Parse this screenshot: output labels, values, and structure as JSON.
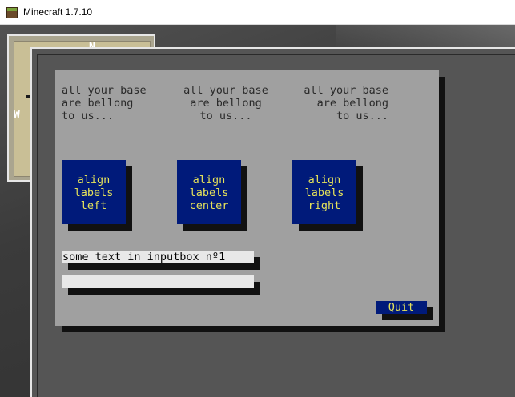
{
  "window": {
    "title": "Minecraft 1.7.10"
  },
  "minimap": {
    "north": "N",
    "west": "W"
  },
  "labels": {
    "left": "all your base\nare bellong\nto us...",
    "center": "all your base\nare bellong\nto us...",
    "right": "all your base\nare bellong\nto us..."
  },
  "buttons": {
    "align_left": "align\nlabels\nleft",
    "align_center": "align\nlabels\ncenter",
    "align_right": "align\nlabels\nright",
    "quit": "Quit"
  },
  "inputs": {
    "first_value": "some text in inputbox nº1",
    "second_value": ""
  },
  "colors": {
    "panel": "#a0a0a0",
    "button_bg": "#001a7a",
    "button_text": "#e5e25a",
    "input_bg": "#e8e8e8"
  }
}
